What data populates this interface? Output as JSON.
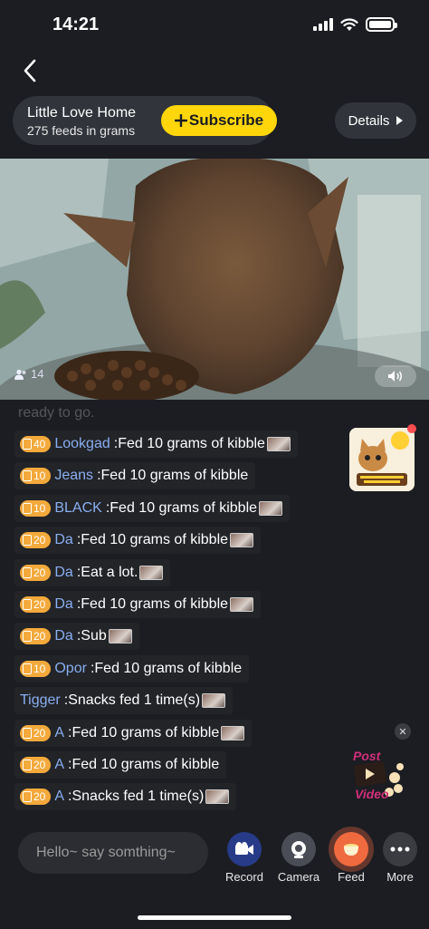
{
  "status": {
    "time": "14:21"
  },
  "header": {
    "home_name": "Little Love Home",
    "home_sub": "275 feeds in grams",
    "subscribe_label": "Subscribe",
    "details_label": "Details"
  },
  "video": {
    "viewer_count": "14"
  },
  "feed": {
    "faded_text": "ready to go.",
    "messages": [
      {
        "level": "40",
        "user": "Lookgad",
        "text": "Fed 10 grams of kibble",
        "has_thumb": true
      },
      {
        "level": "10",
        "user": "Jeans",
        "text": "Fed 10 grams of kibble",
        "has_thumb": false
      },
      {
        "level": "10",
        "user": "BLACK",
        "text": "Fed 10 grams of kibble",
        "has_thumb": true
      },
      {
        "level": "20",
        "user": "Da",
        "text": "Fed 10 grams of kibble",
        "has_thumb": true
      },
      {
        "level": "20",
        "user": "Da",
        "text": "Eat a lot.",
        "has_thumb": true
      },
      {
        "level": "20",
        "user": "Da",
        "text": "Fed 10 grams of kibble",
        "has_thumb": true
      },
      {
        "level": "20",
        "user": "Da",
        "text": "Sub",
        "has_thumb": true
      },
      {
        "level": "10",
        "user": "Opor",
        "text": "Fed 10 grams of kibble",
        "has_thumb": false
      },
      {
        "level": "",
        "user": "Tigger",
        "text": "Snacks fed 1 time(s)",
        "has_thumb": true
      },
      {
        "level": "20",
        "user": "A",
        "text": "Fed 10 grams of kibble",
        "has_thumb": true
      },
      {
        "level": "20",
        "user": "A",
        "text": "Fed 10 grams of kibble",
        "has_thumb": false
      },
      {
        "level": "20",
        "user": "A",
        "text": "Snacks fed 1 time(s)",
        "has_thumb": true
      }
    ]
  },
  "promo": {
    "post_video_line1": "Post",
    "post_video_line2": "Video"
  },
  "bottom": {
    "input_placeholder": "Hello~ say somthing~",
    "actions": {
      "record": "Record",
      "camera": "Camera",
      "feed": "Feed",
      "more": "More"
    }
  },
  "colors": {
    "accent_yellow": "#ffd60a",
    "username_blue": "#8aaef0",
    "level_badge": "#f3a93b",
    "feed_button": "#f06a3f"
  }
}
